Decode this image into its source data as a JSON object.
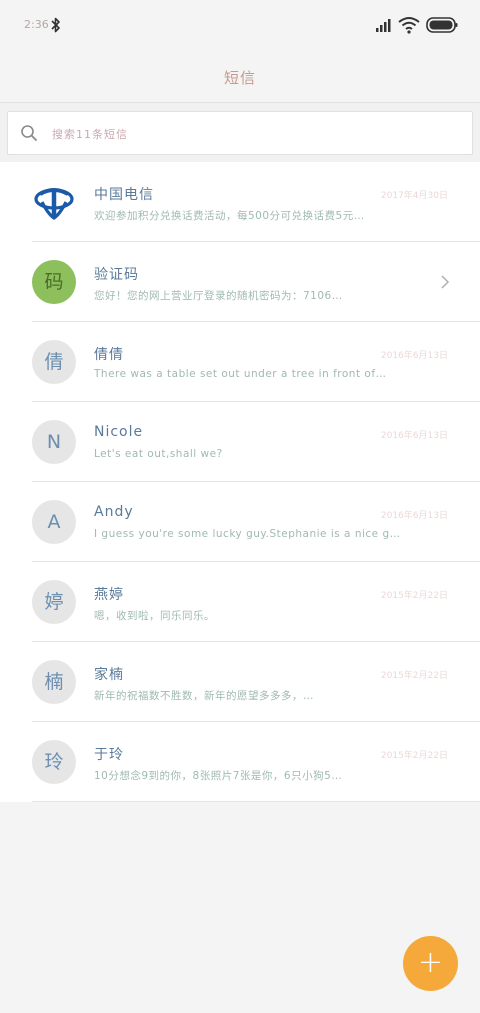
{
  "status_bar": {
    "time": "2:36",
    "icons": [
      "bluetooth-icon",
      "signal-icon",
      "wifi-icon",
      "battery-icon"
    ]
  },
  "header": {
    "title": "短信"
  },
  "search": {
    "placeholder": "搜索11条短信"
  },
  "conversations": [
    {
      "name": "中国电信",
      "date": "2017年4月30日",
      "message": "欢迎参加积分兑换话费活动，每500分可兑换话费5元…",
      "avatar": "telecom-logo",
      "avatar_text": ""
    },
    {
      "name": "验证码",
      "date": "",
      "message": "您好！您的网上营业厅登录的随机密码为：7106…",
      "avatar": "green",
      "avatar_text": "码"
    },
    {
      "name": "倩倩",
      "date": "2016年6月13日",
      "message": "There was a table set out under a tree in front of…",
      "avatar": "gray",
      "avatar_text": "倩"
    },
    {
      "name": "Nicole",
      "date": "2016年6月13日",
      "message": "Let's eat out,shall we?",
      "avatar": "gray",
      "avatar_text": "N"
    },
    {
      "name": "Andy",
      "date": "2016年6月13日",
      "message": "I guess you're some lucky guy.Stephanie is a nice g…",
      "avatar": "gray",
      "avatar_text": "A"
    },
    {
      "name": "燕婷",
      "date": "2015年2月22日",
      "message": "嗯，收到啦，同乐同乐。",
      "avatar": "gray",
      "avatar_text": "婷"
    },
    {
      "name": "家楠",
      "date": "2015年2月22日",
      "message": "新年的祝福数不胜数，新年的愿望多多多，…",
      "avatar": "gray",
      "avatar_text": "楠"
    },
    {
      "name": "于玲",
      "date": "2015年2月22日",
      "message": "10分想念9到的你，8张照片7张是你，6只小狗5…",
      "avatar": "gray",
      "avatar_text": "玲"
    }
  ],
  "fab": {
    "label": "+"
  },
  "colors": {
    "accent": "#f5a93a",
    "avatar_green": "#8dbf5d",
    "telecom_blue": "#1a5aa8"
  }
}
